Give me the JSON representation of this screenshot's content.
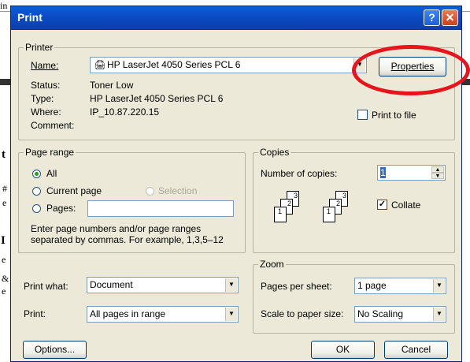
{
  "window": {
    "title": "Print"
  },
  "titlebar": {
    "help_glyph": "?",
    "close_glyph": "✕"
  },
  "background": {
    "chars": [
      "in",
      "t",
      "#",
      "e",
      "I",
      "e",
      "&",
      "e"
    ]
  },
  "printer": {
    "legend": "Printer",
    "name_label": "Name:",
    "name_value": "HP LaserJet 4050 Series PCL 6",
    "properties_button": "Properties",
    "status_label": "Status:",
    "status_value": "Toner Low",
    "type_label": "Type:",
    "type_value": "HP LaserJet 4050 Series PCL 6",
    "where_label": "Where:",
    "where_value": "IP_10.87.220.15",
    "comment_label": "Comment:",
    "print_to_file_label": "Print to file",
    "print_to_file_checked": false
  },
  "page_range": {
    "legend": "Page range",
    "all_label": "All",
    "current_page_label": "Current page",
    "selection_label": "Selection",
    "pages_label": "Pages:",
    "pages_value": "",
    "help_text_1": "Enter page numbers and/or page ranges",
    "help_text_2": "separated by commas.  For example, 1,3,5–12",
    "selected": "All"
  },
  "copies": {
    "legend": "Copies",
    "number_label": "Number of copies:",
    "number_value": "1",
    "collate_label": "Collate",
    "collate_checked": true,
    "collate_icon_pages": [
      "3",
      "2",
      "1",
      "3",
      "2",
      "1"
    ]
  },
  "print_what": {
    "label": "Print what:",
    "value": "Document"
  },
  "print": {
    "label": "Print:",
    "value": "All pages in range"
  },
  "zoom": {
    "legend": "Zoom",
    "pages_per_sheet_label": "Pages per sheet:",
    "pages_per_sheet_value": "1 page",
    "scale_label": "Scale to paper size:",
    "scale_value": "No Scaling"
  },
  "footer": {
    "options_button": "Options...",
    "ok_button": "OK",
    "cancel_button": "Cancel"
  },
  "colors": {
    "title_bar": "#0b4fc6",
    "dialog_bg": "#ece9d8",
    "highlight_circle": "#e8141c"
  }
}
